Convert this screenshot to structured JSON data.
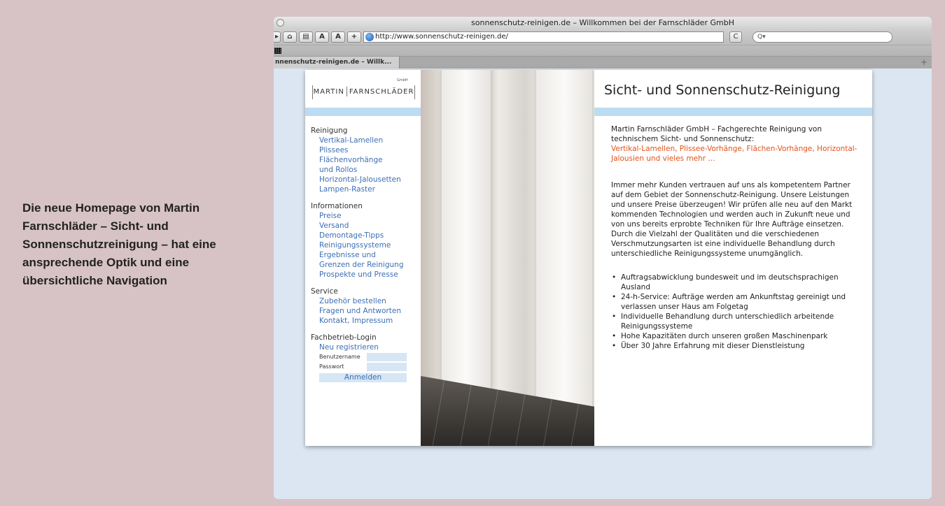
{
  "caption": "Die neue Homepage von Martin Farnschläder – Sicht- und Sonnenschutzreinigung – hat eine ansprechende Optik und eine übersichtliche Navigation",
  "browser": {
    "window_title": "sonnenschutz-reinigen.de – Willkommen bei der Farnschläder GmbH",
    "url": "http://www.sonnenschutz-reinigen.de/",
    "search_placeholder": "Q▾",
    "tab_label": "nnenschutz-reinigen.de – Willk...",
    "toolbar": {
      "back_icon": "back-arrow-icon",
      "home_icon": "home-icon",
      "print_icon": "print-icon",
      "text_smaller": "A",
      "text_larger": "A",
      "add_bookmark": "+",
      "reload": "C"
    }
  },
  "site": {
    "logo_name_1": "MARTIN",
    "logo_name_2": "FARNSCHLÄDER",
    "logo_gmbh": "GmbH",
    "page_title": "Sicht- und Sonnenschutz-Reinigung",
    "nav": {
      "reinigung_head": "Reinigung",
      "reinigung_items": [
        "Vertikal-Lamellen",
        "Plissees",
        "Flächenvorhänge",
        "und Rollos",
        "Horizontal-Jalousetten",
        "Lampen-Raster"
      ],
      "info_head": "Informationen",
      "info_items": [
        "Preise",
        "Versand",
        "Demontage-Tipps",
        "Reinigungssysteme",
        "Ergebnisse und",
        "Grenzen der Reinigung",
        "Prospekte und Presse"
      ],
      "service_head": "Service",
      "service_items": [
        "Zubehör bestellen",
        "Fragen und Antworten",
        "Kontakt, Impressum"
      ],
      "login_head": "Fachbetrieb-Login",
      "register": "Neu registrieren",
      "username_label": "Benutzername",
      "password_label": "Passwort",
      "login_button": "Anmelden"
    },
    "intro_1": "Martin Farnschläder GmbH – Fachgerechte Reinigung von technischem Sicht- und Sonnenschutz:",
    "intro_orange": "Vertikal-Lamellen, Plissee-Vorhänge, Flächen-Vorhänge, Horizontal-Jalousien und vieles mehr ...",
    "paragraph": "Immer mehr Kunden vertrauen auf uns als kompetentem Partner auf dem Gebiet der Sonnenschutz-Reinigung. Unsere Leistungen und unsere Preise überzeugen! Wir prüfen alle neu auf den Markt kommenden Technologien und werden auch in Zukunft neue und von uns bereits erprobte Techniken für Ihre Aufträge einsetzen. Durch die Vielzahl der Qualitäten und die verschiedenen Verschmutzungsarten ist eine individuelle Behandlung durch unterschiedliche Reinigungssysteme unumgänglich.",
    "bullets": [
      "Auftragsabwicklung bundesweit und im deutschsprachigen Ausland",
      "24-h-Service: Aufträge werden am Ankunftstag gereinigt und verlassen unser Haus am Folgetag",
      "Individuelle Behandlung durch unterschiedlich arbeitende Reinigungssysteme",
      "Hohe Kapazitäten durch unseren großen Maschinenpark",
      "Über 30 Jahre Erfahrung mit dieser Dienstleistung"
    ]
  },
  "colors": {
    "background": "#d7c3c5",
    "link": "#3c6fb4",
    "accent_band": "#bcdcf1",
    "orange": "#e2531a"
  }
}
